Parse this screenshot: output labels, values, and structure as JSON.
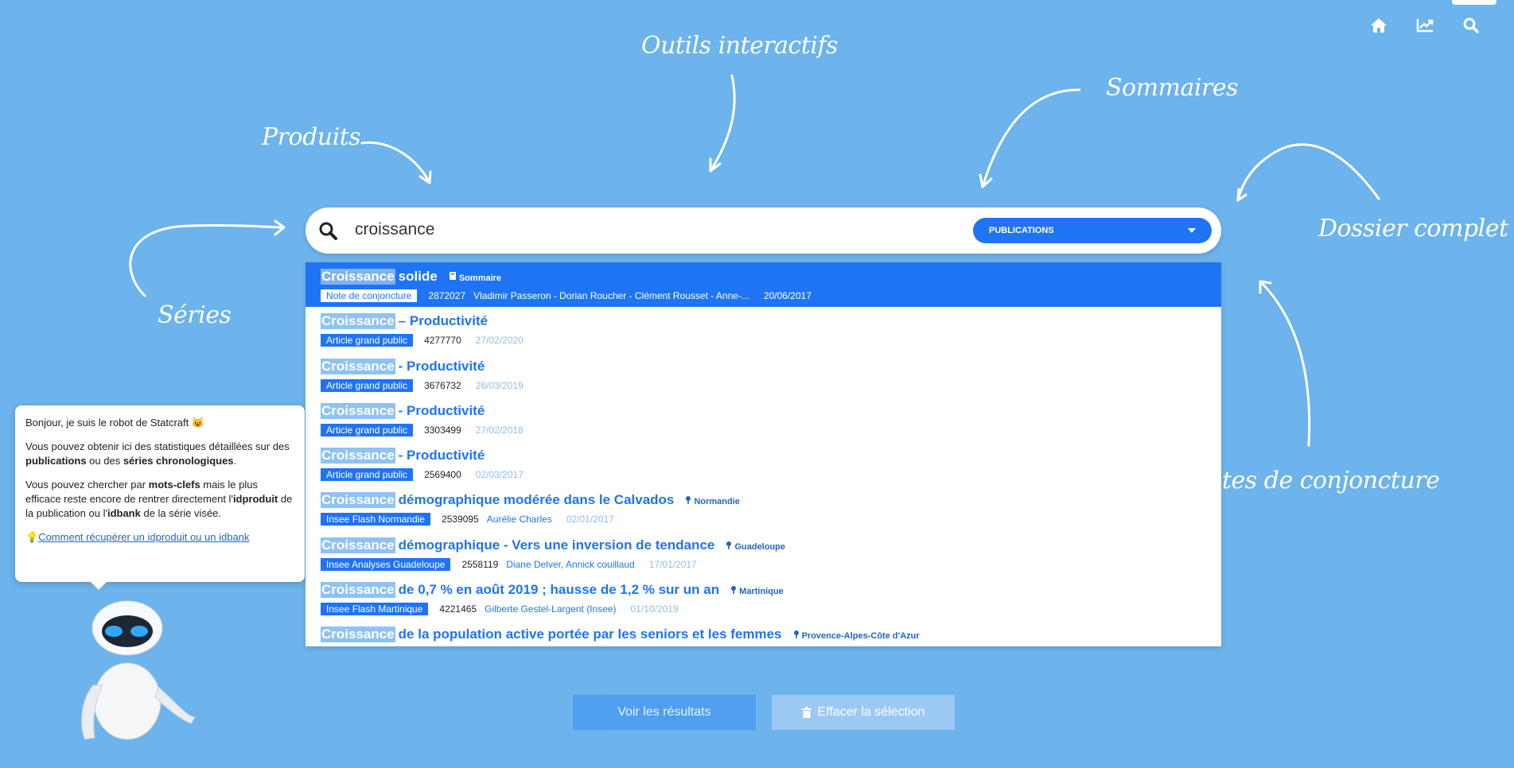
{
  "nav": {
    "home_icon": "home-icon",
    "chart_icon": "chart-icon",
    "search_icon": "search-icon"
  },
  "annotations": {
    "outils": "Outils interactifs",
    "sommaires": "Sommaires",
    "produits": "Produits",
    "series": "Séries",
    "dossier": "Dossier complet",
    "conjoncture": "tes de conjoncture"
  },
  "search": {
    "value": "croissance",
    "filter": "PUBLICATIONS"
  },
  "results": [
    {
      "hl": "Croissance",
      "title": " solide",
      "tag": "Sommaire",
      "badge": "Note de conjoncture",
      "id": "2872027",
      "authors": "Vladimir Passeron - Dorian Roucher - Clément Rousset - Anne-...",
      "date": "20/06/2017"
    },
    {
      "hl": "Croissance",
      "title": " – Productivité",
      "tag": "",
      "badge": "Article grand public",
      "id": "4277770",
      "authors": "",
      "date": "27/02/2020"
    },
    {
      "hl": "Croissance",
      "title": " - Productivité",
      "tag": "",
      "badge": "Article grand public",
      "id": "3676732",
      "authors": "",
      "date": "26/03/2019"
    },
    {
      "hl": "Croissance",
      "title": " - Productivité",
      "tag": "",
      "badge": "Article grand public",
      "id": "3303499",
      "authors": "",
      "date": "27/02/2018"
    },
    {
      "hl": "Croissance",
      "title": " - Productivité",
      "tag": "",
      "badge": "Article grand public",
      "id": "2569400",
      "authors": "",
      "date": "02/03/2017"
    },
    {
      "hl": "Croissance",
      "title": " démographique modérée dans le Calvados",
      "tag": "Normandie",
      "badge": "Insee Flash Normandie",
      "id": "2539095",
      "authors": "Aurélie Charles",
      "date": "02/01/2017"
    },
    {
      "hl": "Croissance",
      "title": " démographique - Vers une inversion de tendance",
      "tag": "Guadeloupe",
      "badge": "Insee Analyses Guadeloupe",
      "id": "2558119",
      "authors": "Diane Delver, Annick couillaud",
      "date": "17/01/2017"
    },
    {
      "hl": "Croissance",
      "title": " de 0,7 % en août 2019 ; hausse de 1,2 % sur un an",
      "tag": "Martinique",
      "badge": "Insee Flash Martinique",
      "id": "4221465",
      "authors": "Gilberte Gestel-Largent (Insee)",
      "date": "01/10/2019"
    },
    {
      "hl": "Croissance",
      "title": " de la population active portée par les seniors et les femmes",
      "tag": "Provence-Alpes-Côte d'Azur",
      "badge": "",
      "id": "",
      "authors": "",
      "date": ""
    }
  ],
  "bot": {
    "greeting": "Bonjour, je suis le robot de Statcraft 😺",
    "p2_a": "Vous pouvez obtenir ici des statistiques détaillées sur des ",
    "p2_b": "publications",
    "p2_c": " ou des ",
    "p2_d": "séries chronologiques",
    "p2_e": ".",
    "p3_a": "Vous pouvez chercher par ",
    "p3_b": "mots-clefs",
    "p3_c": " mais le plus efficace reste encore de rentrer directement l'",
    "p3_d": "idproduit",
    "p3_e": " de la publication ou l'",
    "p3_f": "idbank",
    "p3_g": " de la série visée.",
    "link": "Comment récupérer un idproduit ou un idbank"
  },
  "buttons": {
    "results": "Voir les résultats",
    "clear": "Effacer la sélection"
  }
}
